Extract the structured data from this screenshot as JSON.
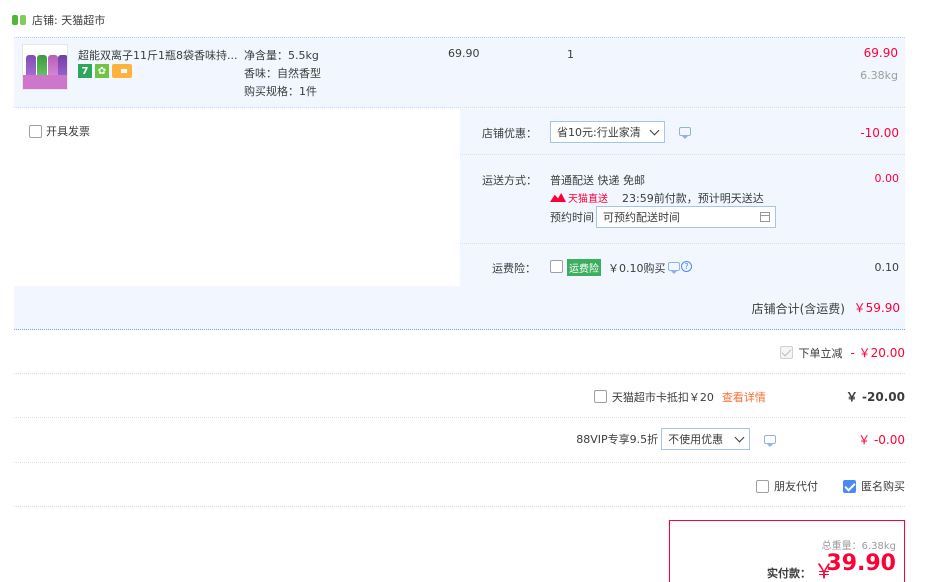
{
  "shop": {
    "label": "店铺: 天猫超市"
  },
  "item": {
    "title": "超能双离子11斤1瓶8袋香味持...",
    "attrs": [
      "净含量：5.5kg",
      "香味：自然香型",
      "购买规格：1件"
    ],
    "unit_price": "69.90",
    "quantity": "1",
    "subtotal": "69.90",
    "weight": "6.38kg",
    "badge_seven": "7"
  },
  "invoice": {
    "label": "开具发票"
  },
  "coupon": {
    "label": "店铺优惠：",
    "selected": "省10元:行业家清",
    "amount": "-10.00"
  },
  "shipping": {
    "label": "运送方式：",
    "method": "普通配送 快递 免邮",
    "tmall_tag": "天猫直送",
    "eta": "23:59前付款，预计明天送达",
    "schedule_label": "预约时间",
    "schedule_placeholder": "可预约配送时间",
    "amount": "0.00"
  },
  "insurance": {
    "label": "运费险：",
    "tag": "运费险",
    "price": "￥0.10购买",
    "amount": "0.10"
  },
  "store_total": {
    "label": "店铺合计(含运费)",
    "amount": "￥59.90"
  },
  "instant_discount": {
    "label": "下单立减",
    "amount": "- ￥20.00"
  },
  "supermarket_card": {
    "label": "天猫超市卡抵扣￥20",
    "link": "查看详情",
    "amount": "￥ -20.00"
  },
  "vip": {
    "label": "88VIP专享9.5折",
    "selected": "不使用优惠",
    "amount": "￥ -0.00"
  },
  "friend_pay": {
    "label": "朋友代付"
  },
  "anonymous": {
    "label": "匿名购买"
  },
  "payment": {
    "weight": "总重量：6.38kg",
    "label": "实付款：",
    "yen": "￥",
    "amount": "39.90"
  },
  "colors": {
    "accent": "#ff0036",
    "panel": "#f2f7ff",
    "link": "#ff6e30",
    "checkbox": "#4a8af4"
  }
}
